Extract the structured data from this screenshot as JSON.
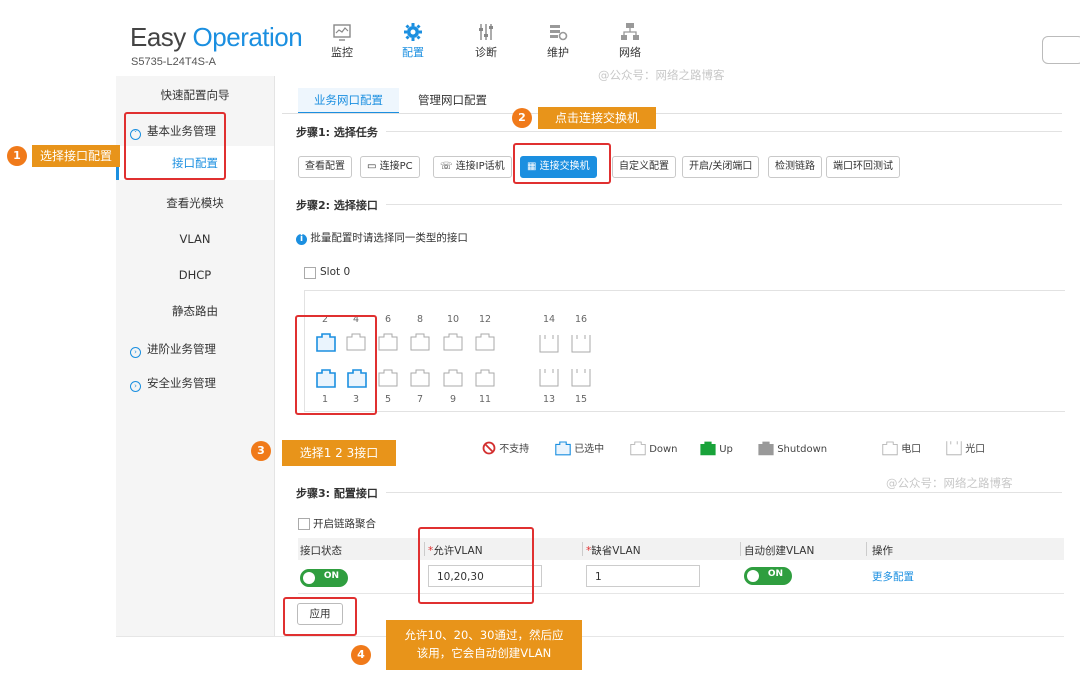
{
  "header": {
    "brand_easy": "Easy",
    "brand_operation": "Operation",
    "model": "S5735-L24T4S-A",
    "nav": [
      {
        "label": "监控",
        "icon": "monitor-icon"
      },
      {
        "label": "配置",
        "icon": "gear-icon",
        "active": true
      },
      {
        "label": "诊断",
        "icon": "sliders-icon"
      },
      {
        "label": "维护",
        "icon": "tools-icon"
      },
      {
        "label": "网络",
        "icon": "network-icon"
      }
    ]
  },
  "sidebar": {
    "items": [
      {
        "label": "快速配置向导"
      },
      {
        "label": "基本业务管理",
        "icon": "collapse-icon"
      },
      {
        "label": "接口配置",
        "active": true
      },
      {
        "label": "查看光模块"
      },
      {
        "label": "VLAN"
      },
      {
        "label": "DHCP"
      },
      {
        "label": "静态路由"
      },
      {
        "label": "进阶业务管理",
        "icon": "expand-icon"
      },
      {
        "label": "安全业务管理",
        "icon": "expand-icon"
      }
    ]
  },
  "tabs": [
    "业务网口配置",
    "管理网口配置"
  ],
  "step1": {
    "title": "步骤1: 选择任务",
    "buttons": [
      "查看配置",
      "连接PC",
      "连接IP话机",
      "连接交换机",
      "自定义配置",
      "开启/关闭端口",
      "检测链路",
      "端口环回测试"
    ],
    "active_index": 3
  },
  "step2": {
    "title": "步骤2: 选择接口",
    "hint": "批量配置时请选择同一类型的接口",
    "slot_label": "Slot 0",
    "top_ports": [
      "2",
      "4",
      "6",
      "8",
      "10",
      "12",
      "14",
      "16"
    ],
    "bottom_ports": [
      "1",
      "3",
      "5",
      "7",
      "9",
      "11",
      "13",
      "15"
    ],
    "selected_ports": [
      "1",
      "2",
      "3"
    ]
  },
  "legend": {
    "unsupported": "不支持",
    "selected": "已选中",
    "down": "Down",
    "up": "Up",
    "shutdown": "Shutdown",
    "copper": "电口",
    "fiber": "光口"
  },
  "step3": {
    "title": "步骤3: 配置接口",
    "link_agg": "开启链路聚合",
    "columns": [
      "接口状态",
      "允许VLAN",
      "缺省VLAN",
      "自动创建VLAN",
      "操作"
    ],
    "required_mark": "*",
    "row": {
      "status": "ON",
      "allowed_vlan": "10,20,30",
      "default_vlan": "1",
      "auto_create": "ON",
      "action": "更多配置"
    },
    "apply": "应用"
  },
  "annotations": {
    "n1": "1",
    "a1": "选择接口配置",
    "n2": "2",
    "a2": "点击连接交换机",
    "n3": "3",
    "a3": "选择1 2 3接口",
    "n4": "4",
    "a4_line1": "允许10、20、30通过，然后应",
    "a4_line2": "该用，它会自动创建VLAN"
  },
  "watermark": "@公众号：网络之路博客",
  "colors": {
    "accent": "#1b8fe0",
    "annotation_orange": "#e8941a",
    "annotation_red": "#e03030",
    "toggle_green": "#2f9e3f"
  }
}
